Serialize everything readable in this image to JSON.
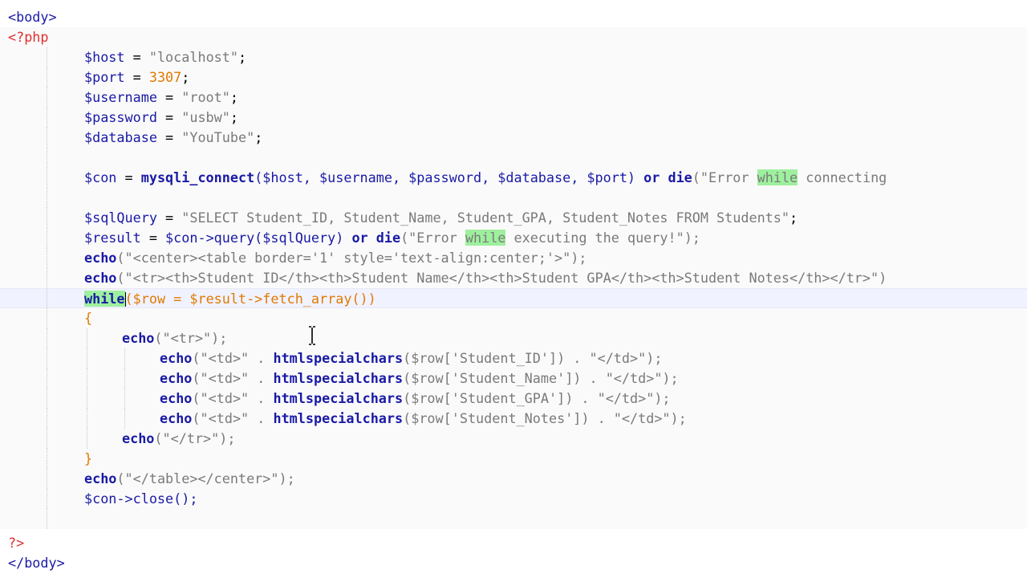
{
  "editor": {
    "tokens": {
      "body_open": "<body>",
      "php_open": "<?php",
      "host_var": "$host",
      "host_val": "\"localhost\"",
      "port_var": "$port",
      "port_val": "3307",
      "user_var": "$username",
      "user_val": "\"root\"",
      "pass_var": "$password",
      "pass_val": "\"usbw\"",
      "db_var": "$database",
      "db_val": "\"YouTube\"",
      "con_var": "$con",
      "connect_fn": "mysqli_connect",
      "connect_args": "($host, $username, $password, $database, $port)",
      "or_die": "or die",
      "err1_a": "(\"Error ",
      "while_word": "while",
      "err1_b": " connecting",
      "sql_var": "$sqlQuery",
      "sql_val": "\"SELECT Student_ID, Student_Name, Student_GPA, Student_Notes FROM Students\"",
      "result_var": "$result",
      "query_call": "$con->query($sqlQuery)",
      "err2_a": "(\"Error ",
      "err2_b": " executing the query!\");",
      "echo_word": "echo",
      "echo_table": "(\"<center><table border='1' style='text-align:center;'>\");",
      "echo_header": "(\"<tr><th>Student ID</th><th>Student Name</th><th>Student GPA</th><th>Student Notes</th></tr>\")",
      "while_kw": "while",
      "while_cond": "($row = $result->fetch_array())",
      "brace_open": "{",
      "echo_tr": "(\"<tr>\");",
      "td_open": "(\"<td>\" . ",
      "hsc_fn": "htmlspecialchars",
      "td_id": "($row['Student_ID']) . \"</td>\");",
      "td_name": "($row['Student_Name']) . \"</td>\");",
      "td_gpa": "($row['Student_GPA']) . \"</td>\");",
      "td_notes": "($row['Student_Notes']) . \"</td>\");",
      "echo_tr_close": "(\"</tr>\");",
      "brace_close": "}",
      "echo_table_close": "(\"</table></center>\");",
      "close_call": "$con->close();",
      "php_close": "?>",
      "body_close": "</body>"
    },
    "colors": {
      "keyword": "#1a1aa6",
      "string": "#7a7a7a",
      "number": "#e07a00",
      "php_tag": "#e03030",
      "highlight": "#9ef09e"
    }
  }
}
